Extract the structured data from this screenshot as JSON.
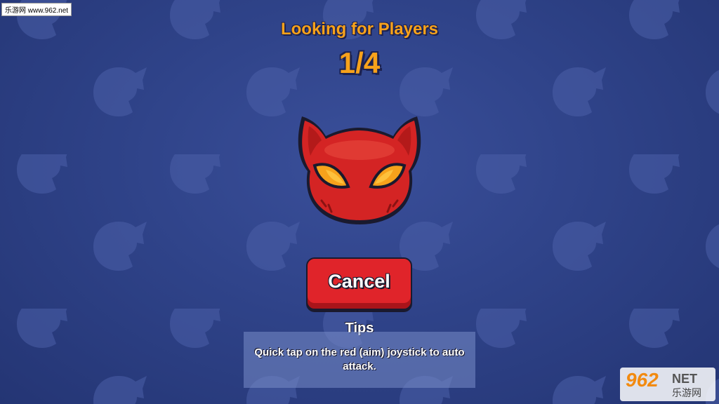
{
  "watermark": {
    "site": "乐游网 www.962.net"
  },
  "matchmaking": {
    "title": "Looking for Players",
    "counter": "1/4"
  },
  "mascot": {
    "icon": "devil-cat-head-icon",
    "color": "#d42424",
    "eye_color": "#f7a21b"
  },
  "cancel_button": {
    "label": "Cancel"
  },
  "tips": {
    "heading": "Tips",
    "text": "Quick tap on the red (aim) joystick to auto attack."
  },
  "corner_logo": {
    "brand_number": "962",
    "brand_suffix": "NET",
    "brand_cn": "乐游网"
  },
  "colors": {
    "accent": "#f7a21b",
    "button_red": "#e0242a",
    "background": "#2f4389",
    "tips_box": "#7a8cc8"
  }
}
